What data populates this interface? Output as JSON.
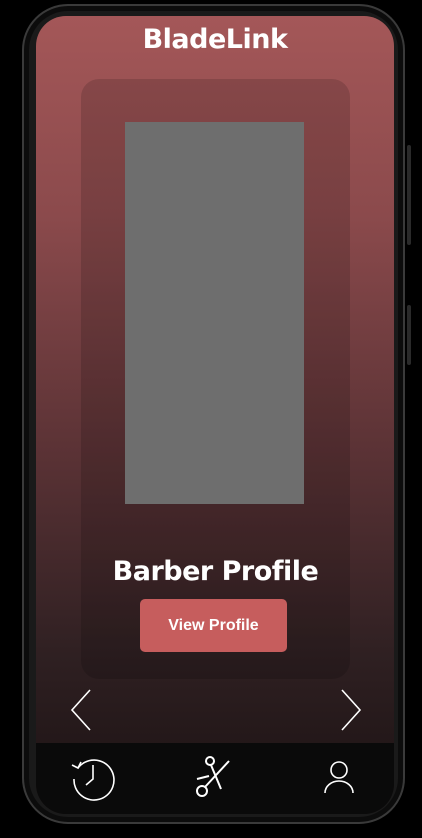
{
  "app": {
    "title": "BladeLink"
  },
  "card": {
    "title": "Barber Profile",
    "button_label": "View Profile"
  },
  "nav": {
    "items": [
      {
        "icon": "history-icon"
      },
      {
        "icon": "scissors-icon"
      },
      {
        "icon": "user-icon"
      }
    ]
  },
  "colors": {
    "accent": "#c65d5d",
    "gradient_top": "#a45758",
    "gradient_bottom": "#1a1112",
    "photo_placeholder": "#6e6e6e",
    "nav_background": "#0a0a0a"
  }
}
